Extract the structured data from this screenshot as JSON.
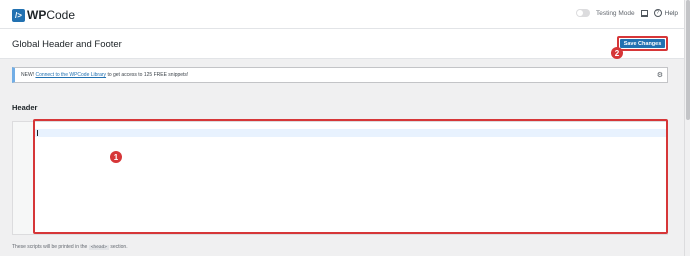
{
  "header": {
    "logo_icon": "/>",
    "logo_brand": "WP",
    "logo_suffix": "Code",
    "testing_mode_label": "Testing Mode",
    "help_label": "Help"
  },
  "title_bar": {
    "title": "Global Header and Footer",
    "save_label": "Save Changes"
  },
  "notice": {
    "prefix": "NEW!",
    "link_text": "Connect to the WPCode Library",
    "suffix": "to get access to 125 FREE snippets!"
  },
  "editor_section": {
    "title": "Header",
    "footer_prefix": "These scripts will be printed in the",
    "footer_code": "<head>",
    "footer_suffix": "section."
  },
  "annotations": {
    "badge_1": "1",
    "badge_2": "2",
    "color": "#d63638"
  },
  "icons": [
    "logo-icon",
    "gear-icon",
    "help-icon",
    "screen-icon"
  ]
}
